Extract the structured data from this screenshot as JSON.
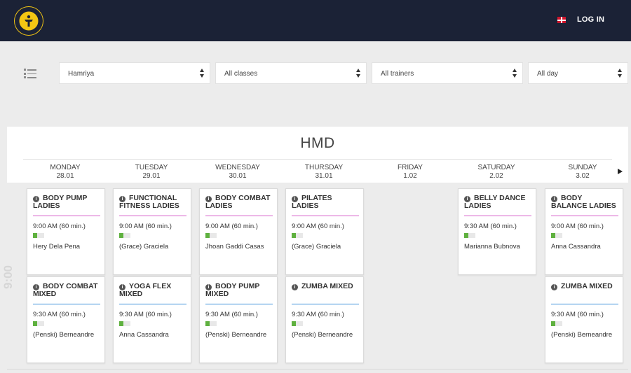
{
  "header": {
    "login_label": "LOG IN",
    "logo_text": "GOLD'S GYM"
  },
  "filters": {
    "location": "Hamriya",
    "classes": "All classes",
    "trainers": "All trainers",
    "day_range": "All day"
  },
  "schedule": {
    "club": "HMD",
    "hour_label": "9:00",
    "days": [
      {
        "name": "MONDAY",
        "date": "28.01"
      },
      {
        "name": "TUESDAY",
        "date": "29.01"
      },
      {
        "name": "WEDNESDAY",
        "date": "30.01"
      },
      {
        "name": "THURSDAY",
        "date": "31.01"
      },
      {
        "name": "FRIDAY",
        "date": "1.02"
      },
      {
        "name": "SATURDAY",
        "date": "2.02"
      },
      {
        "name": "SUNDAY",
        "date": "3.02"
      }
    ],
    "classes": [
      {
        "name": "BODY PUMP LADIES",
        "time": "9:00 AM  (60 min.)",
        "trainer": "Hery Dela Pena",
        "fill": 0.35,
        "color": "#d65cc9"
      },
      {
        "name": "FUNCTIONAL FITNESS LADIES",
        "time": "9:00 AM  (60 min.)",
        "trainer": "(Grace) Graciela",
        "fill": 0.35,
        "color": "#d65cc9"
      },
      {
        "name": "BODY COMBAT LADIES",
        "time": "9:00 AM  (60 min.)",
        "trainer": "Jhoan Gaddi Casas",
        "fill": 0.35,
        "color": "#d65cc9"
      },
      {
        "name": "PILATES LADIES",
        "time": "9:00 AM  (60 min.)",
        "trainer": "(Grace) Graciela",
        "fill": 0.35,
        "color": "#d65cc9"
      },
      {
        "name": "BELLY DANCE LADIES",
        "time": "9:30 AM  (60 min.)",
        "trainer": "Marianna Bubnova",
        "fill": 0.35,
        "color": "#d65cc9"
      },
      {
        "name": "BODY BALANCE LADIES",
        "time": "9:00 AM  (60 min.)",
        "trainer": "Anna Cassandra",
        "fill": 0.35,
        "color": "#d65cc9"
      },
      {
        "name": "BODY COMBAT MIXED",
        "time": "9:30 AM  (60 min.)",
        "trainer": "(Penski) Berneandre",
        "fill": 0.35,
        "color": "#3a8fd9"
      },
      {
        "name": "YOGA FLEX MIXED",
        "time": "9:30 AM  (60 min.)",
        "trainer": "Anna Cassandra",
        "fill": 0.35,
        "color": "#3a8fd9"
      },
      {
        "name": "BODY PUMP MIXED",
        "time": "9:30 AM  (60 min.)",
        "trainer": "(Penski) Berneandre",
        "fill": 0.35,
        "color": "#3a8fd9"
      },
      {
        "name": "ZUMBA MIXED",
        "time": "9:30 AM  (60 min.)",
        "trainer": "(Penski) Berneandre",
        "fill": 0.35,
        "color": "#3a8fd9"
      },
      {
        "name": "ZUMBA MIXED",
        "time": "9:30 AM  (60 min.)",
        "trainer": "(Penski) Berneandre",
        "fill": 0.35,
        "color": "#3a8fd9"
      }
    ]
  }
}
